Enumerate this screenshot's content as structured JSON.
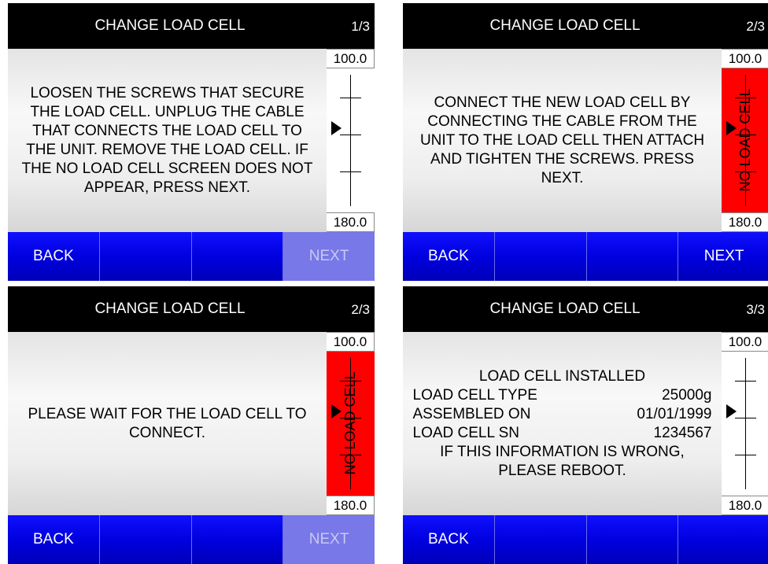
{
  "colors": {
    "header_bg": "#000000",
    "button_blue": "#0000ee",
    "disabled_button": "#7878e8",
    "warning_red": "#ff0000"
  },
  "gauge": {
    "top": "100.0",
    "bottom": "180.0",
    "no_load_cell_label": "NO LOAD CELL",
    "pointer_icon": "right-triangle-pointer"
  },
  "panels": [
    {
      "title": "CHANGE LOAD CELL",
      "page": "1/3",
      "message": "LOOSEN THE SCREWS THAT SECURE THE LOAD CELL. UNPLUG THE CABLE THAT CONNECTS THE LOAD CELL TO THE UNIT. REMOVE THE LOAD CELL. IF THE NO LOAD CELL SCREEN DOES NOT APPEAR, PRESS NEXT.",
      "buttons": {
        "back": "BACK",
        "next": "NEXT"
      },
      "next_enabled": false
    },
    {
      "title": "CHANGE LOAD CELL",
      "page": "2/3",
      "message": "CONNECT THE NEW LOAD CELL BY CONNECTING THE CABLE FROM THE UNIT TO THE LOAD CELL THEN ATTACH AND TIGHTEN THE SCREWS. PRESS NEXT.",
      "buttons": {
        "back": "BACK",
        "next": "NEXT"
      },
      "next_enabled": true
    },
    {
      "title": "CHANGE LOAD CELL",
      "page": "2/3",
      "message": "PLEASE WAIT FOR THE LOAD CELL TO CONNECT.",
      "buttons": {
        "back": "BACK",
        "next": "NEXT"
      },
      "next_enabled": false
    },
    {
      "title": "CHANGE LOAD CELL",
      "page": "3/3",
      "installed_heading": "LOAD CELL INSTALLED",
      "rows": [
        {
          "label": "LOAD CELL TYPE",
          "value": "25000g"
        },
        {
          "label": "ASSEMBLED ON",
          "value": "01/01/1999"
        },
        {
          "label": "LOAD CELL SN",
          "value": "1234567"
        }
      ],
      "footer_note": "IF THIS INFORMATION IS WRONG, PLEASE REBOOT.",
      "buttons": {
        "back": "BACK"
      }
    }
  ]
}
